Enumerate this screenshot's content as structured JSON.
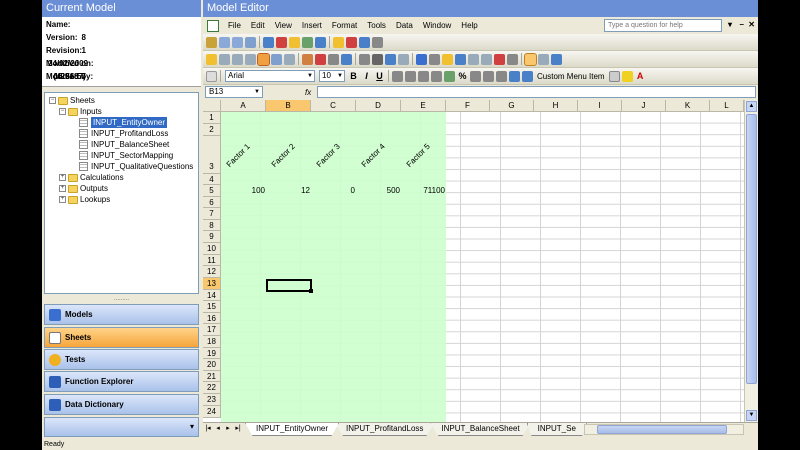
{
  "left_panel": {
    "title": "Current Model",
    "properties": [
      {
        "label": "Name:",
        "value": ""
      },
      {
        "label": "Version:",
        "value": "8"
      },
      {
        "label": "Revision:",
        "value": "1"
      },
      {
        "label": "Modified on:",
        "value": "24/02/2009 15:56:57"
      },
      {
        "label": "Modified by:",
        "value": "{422187}"
      }
    ],
    "tree": {
      "root": "Sheets",
      "inputs_label": "Inputs",
      "input_sheets": [
        "INPUT_EntityOwner",
        "INPUT_ProfitandLoss",
        "INPUT_BalanceSheet",
        "INPUT_SectorMapping",
        "INPUT_QualitativeQuestions"
      ],
      "selected": "INPUT_EntityOwner",
      "other_folders": [
        "Calculations",
        "Outputs",
        "Lookups"
      ]
    },
    "nav_buttons": [
      {
        "label": "Models",
        "icon": "models-icon",
        "color": "#3a6fcf"
      },
      {
        "label": "Sheets",
        "icon": "sheets-icon",
        "color": "#ffffff",
        "active": true
      },
      {
        "label": "Tests",
        "icon": "tests-icon",
        "color": "#f0b020"
      },
      {
        "label": "Function Explorer",
        "icon": "function-explorer-icon",
        "color": "#2e5fb8"
      },
      {
        "label": "Data Dictionary",
        "icon": "data-dictionary-icon",
        "color": "#2e5fb8"
      }
    ]
  },
  "editor": {
    "title": "Model Editor",
    "menu": [
      "File",
      "Edit",
      "View",
      "Insert",
      "Format",
      "Tools",
      "Data",
      "Window",
      "Help"
    ],
    "help_placeholder": "Type a question for help",
    "font_name": "Arial",
    "font_size": "10",
    "custom_menu_label": "Custom Menu Item",
    "name_box": "B13",
    "fx_label": "fx",
    "columns": [
      "A",
      "B",
      "C",
      "D",
      "E",
      "F",
      "G",
      "H",
      "I",
      "J",
      "K",
      "L"
    ],
    "selected_column": "B",
    "selected_row": "13",
    "rows": [
      "1",
      "2",
      "3",
      "4",
      "5",
      "6",
      "7",
      "8",
      "9",
      "10",
      "11",
      "12",
      "13",
      "14",
      "15",
      "16",
      "17",
      "18",
      "19",
      "20",
      "21",
      "22",
      "23",
      "24"
    ],
    "factor_headers": [
      "Factor 1",
      "Factor 2",
      "Factor 3",
      "Factor 4",
      "Factor 5"
    ],
    "row5_values": [
      "100",
      "12",
      "0",
      "500",
      "71100"
    ],
    "sheet_tabs": [
      "INPUT_EntityOwner",
      "INPUT_ProfitandLoss",
      "INPUT_BalanceSheet",
      "INPUT_Se"
    ],
    "active_tab": "INPUT_EntityOwner",
    "input_area_color": "#ccffcc",
    "accent": "#6b8fd6"
  },
  "status": "Ready"
}
